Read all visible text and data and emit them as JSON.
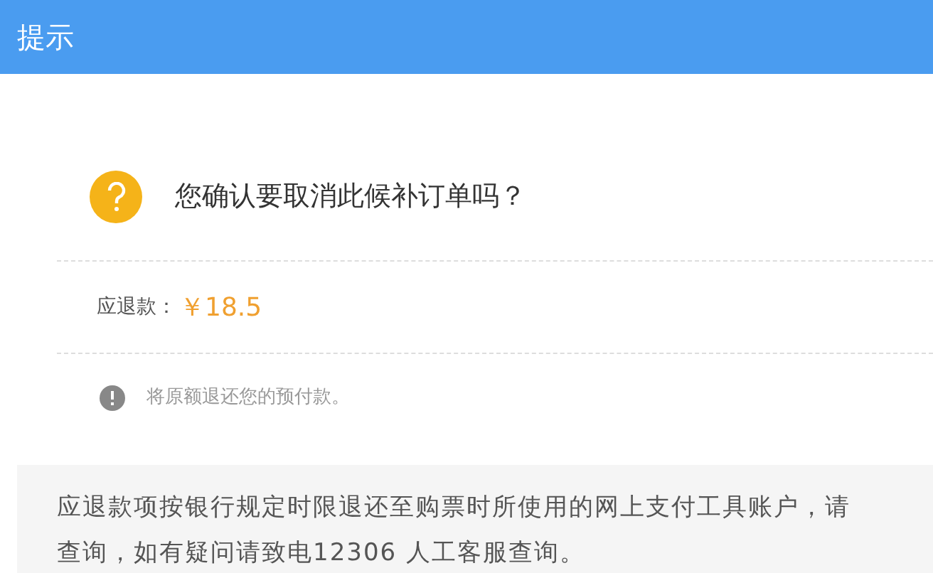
{
  "dialog": {
    "title": "提示"
  },
  "question": "您确认要取消此候补订单吗？",
  "refund": {
    "label": "应退款：",
    "amount": "￥18.5"
  },
  "info": "将原额退还您的预付款。",
  "notice_lines": [
    "应退款项按银行规定时限退还至购票时所使用的网上支付工具账户，请",
    "查询，如有疑问请致电12306 人工客服查询。"
  ]
}
